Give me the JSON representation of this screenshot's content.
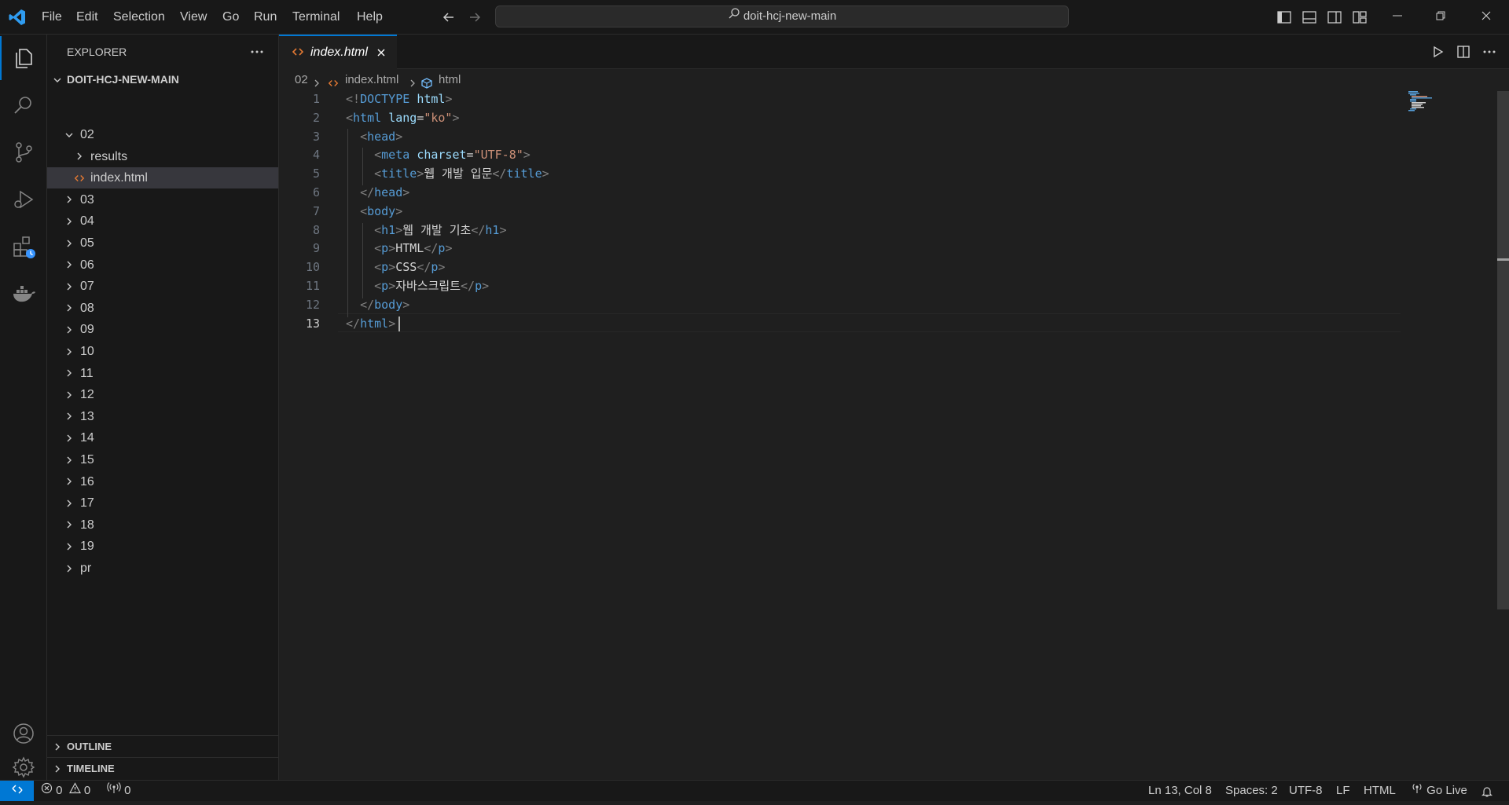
{
  "menu": [
    "File",
    "Edit",
    "Selection",
    "View",
    "Go",
    "Run",
    "Terminal",
    "Help"
  ],
  "search": {
    "text": "doit-hcj-new-main"
  },
  "explorer": {
    "title": "EXPLORER",
    "root": "DOIT-HCJ-NEW-MAIN",
    "items": [
      {
        "label": "02",
        "depth": 1,
        "expanded": true
      },
      {
        "label": "results",
        "depth": 2,
        "expanded": false
      },
      {
        "label": "index.html",
        "depth": 2,
        "file": true,
        "selected": true
      },
      {
        "label": "03",
        "depth": 1
      },
      {
        "label": "04",
        "depth": 1
      },
      {
        "label": "05",
        "depth": 1
      },
      {
        "label": "06",
        "depth": 1
      },
      {
        "label": "07",
        "depth": 1
      },
      {
        "label": "08",
        "depth": 1
      },
      {
        "label": "09",
        "depth": 1
      },
      {
        "label": "10",
        "depth": 1
      },
      {
        "label": "11",
        "depth": 1
      },
      {
        "label": "12",
        "depth": 1
      },
      {
        "label": "13",
        "depth": 1
      },
      {
        "label": "14",
        "depth": 1
      },
      {
        "label": "15",
        "depth": 1
      },
      {
        "label": "16",
        "depth": 1
      },
      {
        "label": "17",
        "depth": 1
      },
      {
        "label": "18",
        "depth": 1
      },
      {
        "label": "19",
        "depth": 1
      },
      {
        "label": "pr",
        "depth": 1
      }
    ],
    "outline": "OUTLINE",
    "timeline": "TIMELINE"
  },
  "tab": {
    "label": "index.html"
  },
  "breadcrumb": {
    "folder": "02",
    "file": "index.html",
    "symbol": "html"
  },
  "code": {
    "line_numbers": [
      "1",
      "2",
      "3",
      "4",
      "5",
      "6",
      "7",
      "8",
      "9",
      "10",
      "11",
      "12",
      "13"
    ],
    "active_line": "13",
    "lines": [
      [
        [
          "tg",
          "<!"
        ],
        [
          "tn",
          "DOCTYPE"
        ],
        [
          "tx",
          " "
        ],
        [
          "at",
          "html"
        ],
        [
          "tg",
          ">"
        ]
      ],
      [
        [
          "tg",
          "<"
        ],
        [
          "tn",
          "html"
        ],
        [
          "tx",
          " "
        ],
        [
          "at",
          "lang"
        ],
        [
          "tx",
          "="
        ],
        [
          "st",
          "\"ko\""
        ],
        [
          "tg",
          ">"
        ]
      ],
      [
        [
          "tx",
          "  "
        ],
        [
          "tg",
          "<"
        ],
        [
          "tn",
          "head"
        ],
        [
          "tg",
          ">"
        ]
      ],
      [
        [
          "tx",
          "    "
        ],
        [
          "tg",
          "<"
        ],
        [
          "tn",
          "meta"
        ],
        [
          "tx",
          " "
        ],
        [
          "at",
          "charset"
        ],
        [
          "tx",
          "="
        ],
        [
          "st",
          "\"UTF-8\""
        ],
        [
          "tg",
          ">"
        ]
      ],
      [
        [
          "tx",
          "    "
        ],
        [
          "tg",
          "<"
        ],
        [
          "tn",
          "title"
        ],
        [
          "tg",
          ">"
        ],
        [
          "tx",
          "웹 개발 입문"
        ],
        [
          "tg",
          "</"
        ],
        [
          "tn",
          "title"
        ],
        [
          "tg",
          ">"
        ]
      ],
      [
        [
          "tx",
          "  "
        ],
        [
          "tg",
          "</"
        ],
        [
          "tn",
          "head"
        ],
        [
          "tg",
          ">"
        ]
      ],
      [
        [
          "tx",
          "  "
        ],
        [
          "tg",
          "<"
        ],
        [
          "tn",
          "body"
        ],
        [
          "tg",
          ">"
        ]
      ],
      [
        [
          "tx",
          "    "
        ],
        [
          "tg",
          "<"
        ],
        [
          "tn",
          "h1"
        ],
        [
          "tg",
          ">"
        ],
        [
          "tx",
          "웹 개발 기초"
        ],
        [
          "tg",
          "</"
        ],
        [
          "tn",
          "h1"
        ],
        [
          "tg",
          ">"
        ]
      ],
      [
        [
          "tx",
          "    "
        ],
        [
          "tg",
          "<"
        ],
        [
          "tn",
          "p"
        ],
        [
          "tg",
          ">"
        ],
        [
          "tx",
          "HTML"
        ],
        [
          "tg",
          "</"
        ],
        [
          "tn",
          "p"
        ],
        [
          "tg",
          ">"
        ]
      ],
      [
        [
          "tx",
          "    "
        ],
        [
          "tg",
          "<"
        ],
        [
          "tn",
          "p"
        ],
        [
          "tg",
          ">"
        ],
        [
          "tx",
          "CSS"
        ],
        [
          "tg",
          "</"
        ],
        [
          "tn",
          "p"
        ],
        [
          "tg",
          ">"
        ]
      ],
      [
        [
          "tx",
          "    "
        ],
        [
          "tg",
          "<"
        ],
        [
          "tn",
          "p"
        ],
        [
          "tg",
          ">"
        ],
        [
          "tx",
          "자바스크립트"
        ],
        [
          "tg",
          "</"
        ],
        [
          "tn",
          "p"
        ],
        [
          "tg",
          ">"
        ]
      ],
      [
        [
          "tx",
          "  "
        ],
        [
          "tg",
          "</"
        ],
        [
          "tn",
          "body"
        ],
        [
          "tg",
          ">"
        ]
      ],
      [
        [
          "tg",
          "</"
        ],
        [
          "tn",
          "html"
        ],
        [
          "tg",
          ">"
        ]
      ]
    ]
  },
  "status": {
    "errors": "0",
    "warnings": "0",
    "ports": "0",
    "position": "Ln 13, Col 8",
    "spaces": "Spaces: 2",
    "encoding": "UTF-8",
    "eol": "LF",
    "language": "HTML",
    "golive": "Go Live"
  },
  "colors": {
    "accent": "#0078d4",
    "background": "#1f1f1f",
    "sidebar": "#181818"
  }
}
